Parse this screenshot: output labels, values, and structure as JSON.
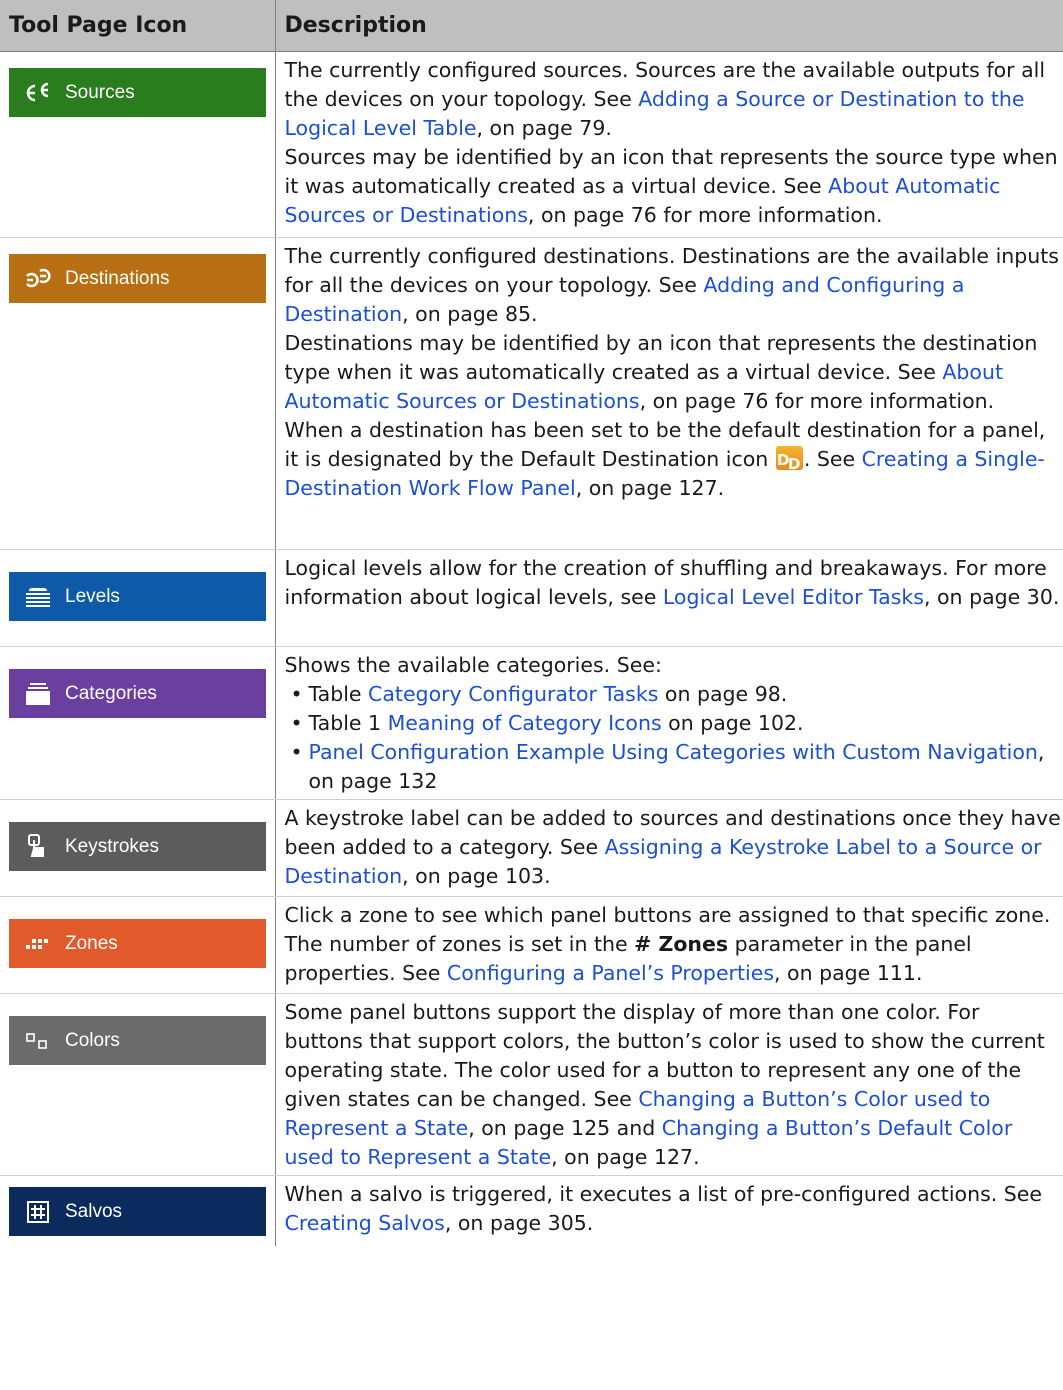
{
  "header": {
    "col1": "Tool Page Icon",
    "col2": "Description"
  },
  "rows": [
    {
      "tool": {
        "label": "Sources",
        "icon": "sources-icon",
        "color": "#2a7d1c"
      },
      "desc": [
        [
          "The currently configured sources. Sources are the available outputs for all the devices on your topology. See ",
          "Adding a Source or Destination to the Logical Level Table",
          ", on page 79."
        ],
        [
          "Sources may be identified by an icon that represents the source type when it was automatically created as a virtual device. See ",
          "About Automatic Sources or Destinations",
          ", on page 76 for more information."
        ]
      ]
    },
    {
      "tool": {
        "label": "Destinations",
        "icon": "destinations-icon",
        "color": "#b86e12"
      },
      "desc": [
        [
          "The currently configured destinations. Destinations are the available inputs for all the devices on your topology. See ",
          "Adding and Configuring a Destination",
          ", on page 85."
        ],
        [
          "Destinations may be identified by an icon that represents the destination type when it was automatically created as a virtual device. See ",
          "About Automatic Sources or Destinations",
          ", on page 76 for more information."
        ],
        [
          "When a destination has been set to be the default destination for a panel, it is designated by the Default Destination icon ",
          ". See ",
          "Creating a Single-Destination Work Flow Panel",
          ", on page 127."
        ]
      ]
    },
    {
      "tool": {
        "label": "Levels",
        "icon": "levels-icon",
        "color": "#0e5aa8"
      },
      "desc": [
        [
          "Logical levels allow for the creation of shuffling and breakaways. For more information about logical levels, see ",
          "Logical Level Editor Tasks",
          ", on page 30."
        ]
      ]
    },
    {
      "tool": {
        "label": "Categories",
        "icon": "categories-icon",
        "color": "#6a3fa0"
      },
      "intro": "Shows the available categories. See:",
      "bullets": [
        [
          "Table  ",
          "Category Configurator Tasks",
          " on page 98."
        ],
        [
          "Table 1 ",
          "Meaning of Category Icons",
          " on page 102."
        ],
        [
          "",
          "Panel Configuration Example Using Categories with Custom Navigation",
          ", on page 132"
        ]
      ]
    },
    {
      "tool": {
        "label": "Keystrokes",
        "icon": "keystrokes-icon",
        "color": "#5c5c5c"
      },
      "desc": [
        [
          "A keystroke label can be added to sources and destinations once they have been added to a category. See ",
          "Assigning a Keystroke Label to a Source or Destination",
          ", on page 103."
        ]
      ]
    },
    {
      "tool": {
        "label": "Zones",
        "icon": "zones-icon",
        "color": "#e05a2b"
      },
      "desc": [
        [
          "Click a zone to see which panel buttons are assigned to that specific zone. The number of zones is set in the ",
          "# Zones",
          " parameter in the panel properties. See ",
          "Configuring a Panel’s Properties",
          ", on page 111."
        ]
      ]
    },
    {
      "tool": {
        "label": "Colors",
        "icon": "colors-icon",
        "color": "#6b6b6b"
      },
      "desc": [
        [
          "Some panel buttons support the display of more than one color. For buttons that support colors, the button’s color is used to show the current operating state. The color used for a button to represent any one of the given states can be changed. See ",
          "Changing a Button’s Color used to Represent a State",
          ", on page 125 and ",
          "Changing a Button’s Default Color used to Represent a State",
          ", on page 127."
        ]
      ]
    },
    {
      "tool": {
        "label": "Salvos",
        "icon": "salvos-icon",
        "color": "#0b2a5e"
      },
      "desc": [
        [
          "When a salvo is triggered, it executes a list of pre-configured actions. See ",
          "Creating Salvos",
          ", on page 305."
        ]
      ]
    }
  ],
  "colors": {
    "link": "#1a4fd6",
    "header_bg": "#bfbfbf",
    "default_destination_icon": "#f0a020"
  }
}
